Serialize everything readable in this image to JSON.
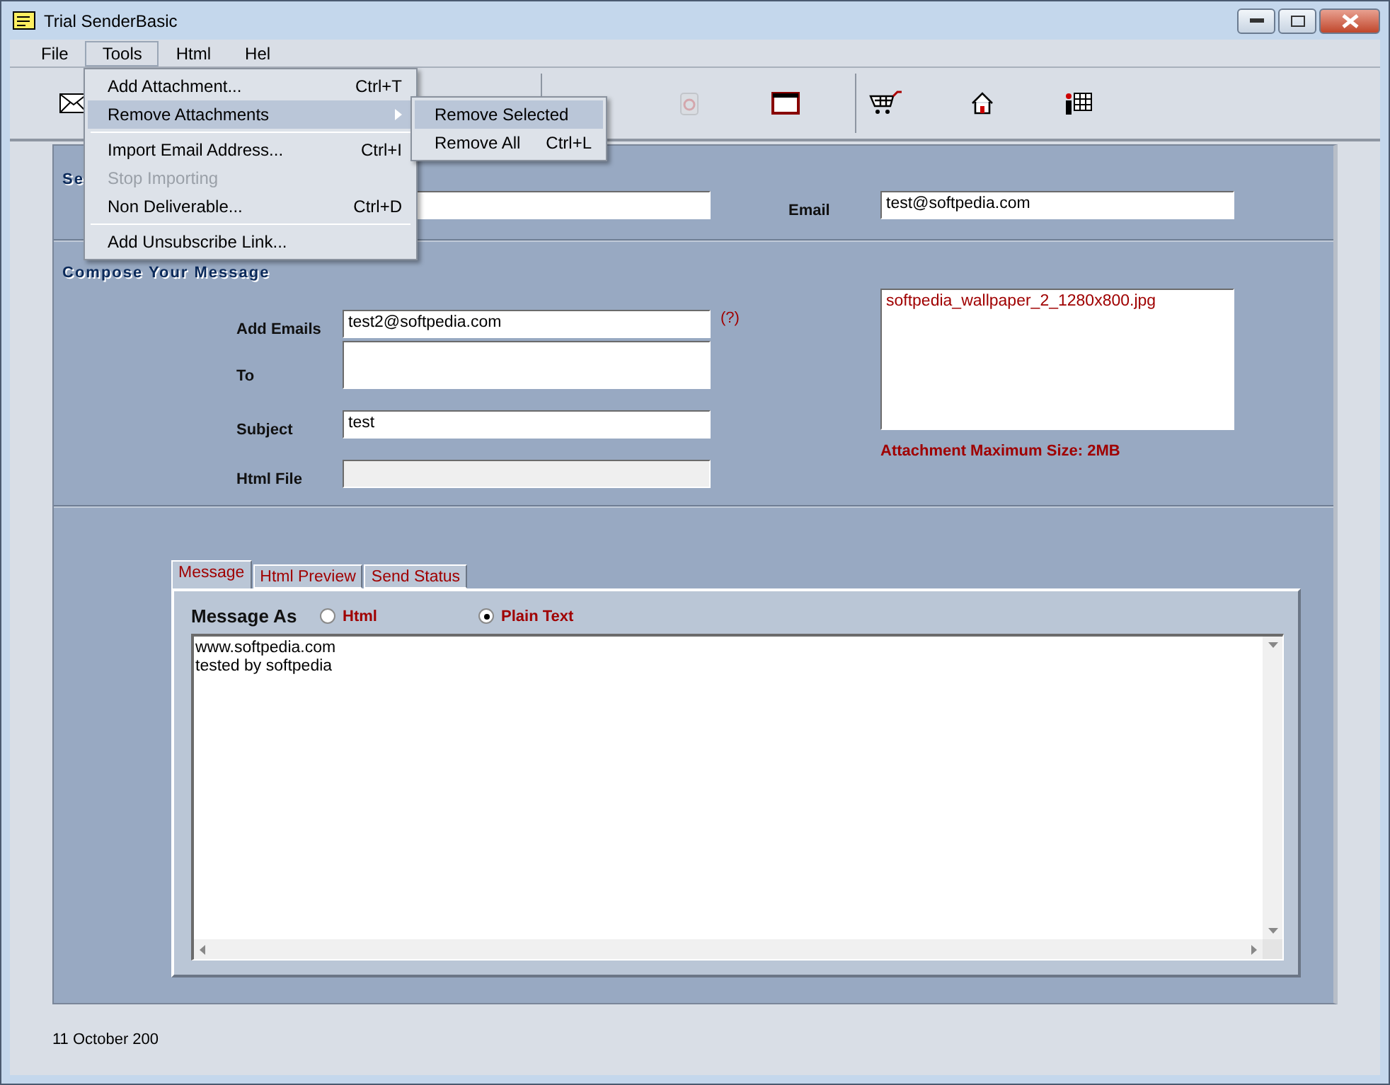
{
  "window": {
    "title": "Trial SenderBasic"
  },
  "menu_bar": [
    {
      "label": "File",
      "selected": false
    },
    {
      "label": "Tools",
      "selected": true
    },
    {
      "label": "Html",
      "selected": false
    },
    {
      "label": "Hel",
      "selected": false
    }
  ],
  "open_menu": {
    "items": [
      {
        "kind": "item",
        "label": "Add Attachment...",
        "shortcut": "Ctrl+T",
        "selected": false,
        "disabled": false,
        "submenu": false
      },
      {
        "kind": "item",
        "label": "Remove Attachments",
        "selected": true,
        "disabled": false,
        "submenu": true
      },
      {
        "kind": "separator"
      },
      {
        "kind": "item",
        "label": "Import Email Address...",
        "shortcut": "Ctrl+I",
        "selected": false,
        "disabled": false,
        "submenu": false
      },
      {
        "kind": "item",
        "label": "Stop Importing",
        "selected": false,
        "disabled": true,
        "submenu": false
      },
      {
        "kind": "item",
        "label": "Non Deliverable...",
        "shortcut": "Ctrl+D",
        "selected": false,
        "disabled": false,
        "submenu": false
      },
      {
        "kind": "separator"
      },
      {
        "kind": "item",
        "label": "Add Unsubscribe Link...",
        "selected": false,
        "disabled": false,
        "submenu": false
      }
    ]
  },
  "submenu": {
    "items": [
      {
        "label": "Remove Selected",
        "selected": true
      },
      {
        "label": "Remove All",
        "shortcut": "Ctrl+L",
        "selected": false
      }
    ]
  },
  "toolbar": {
    "groups": [
      [
        {
          "kind": "envelope",
          "disabled": false
        }
      ],
      [
        {
          "kind": "recycle",
          "disabled": true
        },
        {
          "kind": "window",
          "disabled": false
        }
      ],
      [
        {
          "kind": "cart",
          "disabled": false
        },
        {
          "kind": "home",
          "disabled": false
        },
        {
          "kind": "people",
          "disabled": false
        }
      ]
    ]
  },
  "sender": {
    "label": "Se",
    "email_label": "Email",
    "email_value": "test@softpedia.com"
  },
  "compose": {
    "heading": "Compose Your Message",
    "fields": [
      {
        "kind": "text",
        "label": "Add Emails",
        "value": "test2@softpedia.com",
        "help": "(?)"
      },
      {
        "kind": "multiline",
        "label": "To"
      },
      {
        "kind": "text",
        "label": "Subject",
        "value": "test"
      },
      {
        "kind": "disabled",
        "label": "Html File"
      }
    ],
    "attachments": [
      "softpedia_wallpaper_2_1280x800.jpg"
    ],
    "attachment_note": "Attachment Maximum Size: 2MB"
  },
  "tabs": [
    {
      "label": "Message",
      "selected": true
    },
    {
      "label": "Html Preview",
      "selected": false
    },
    {
      "label": "Send Status",
      "selected": false
    }
  ],
  "message_as": {
    "label": "Message As",
    "options": [
      {
        "label": "Html",
        "selected": false
      },
      {
        "label": "Plain Text",
        "selected": true
      }
    ]
  },
  "message_body": "www.softpedia.com\ntested by softpedia",
  "status_bar": {
    "date": "11 October 200"
  }
}
